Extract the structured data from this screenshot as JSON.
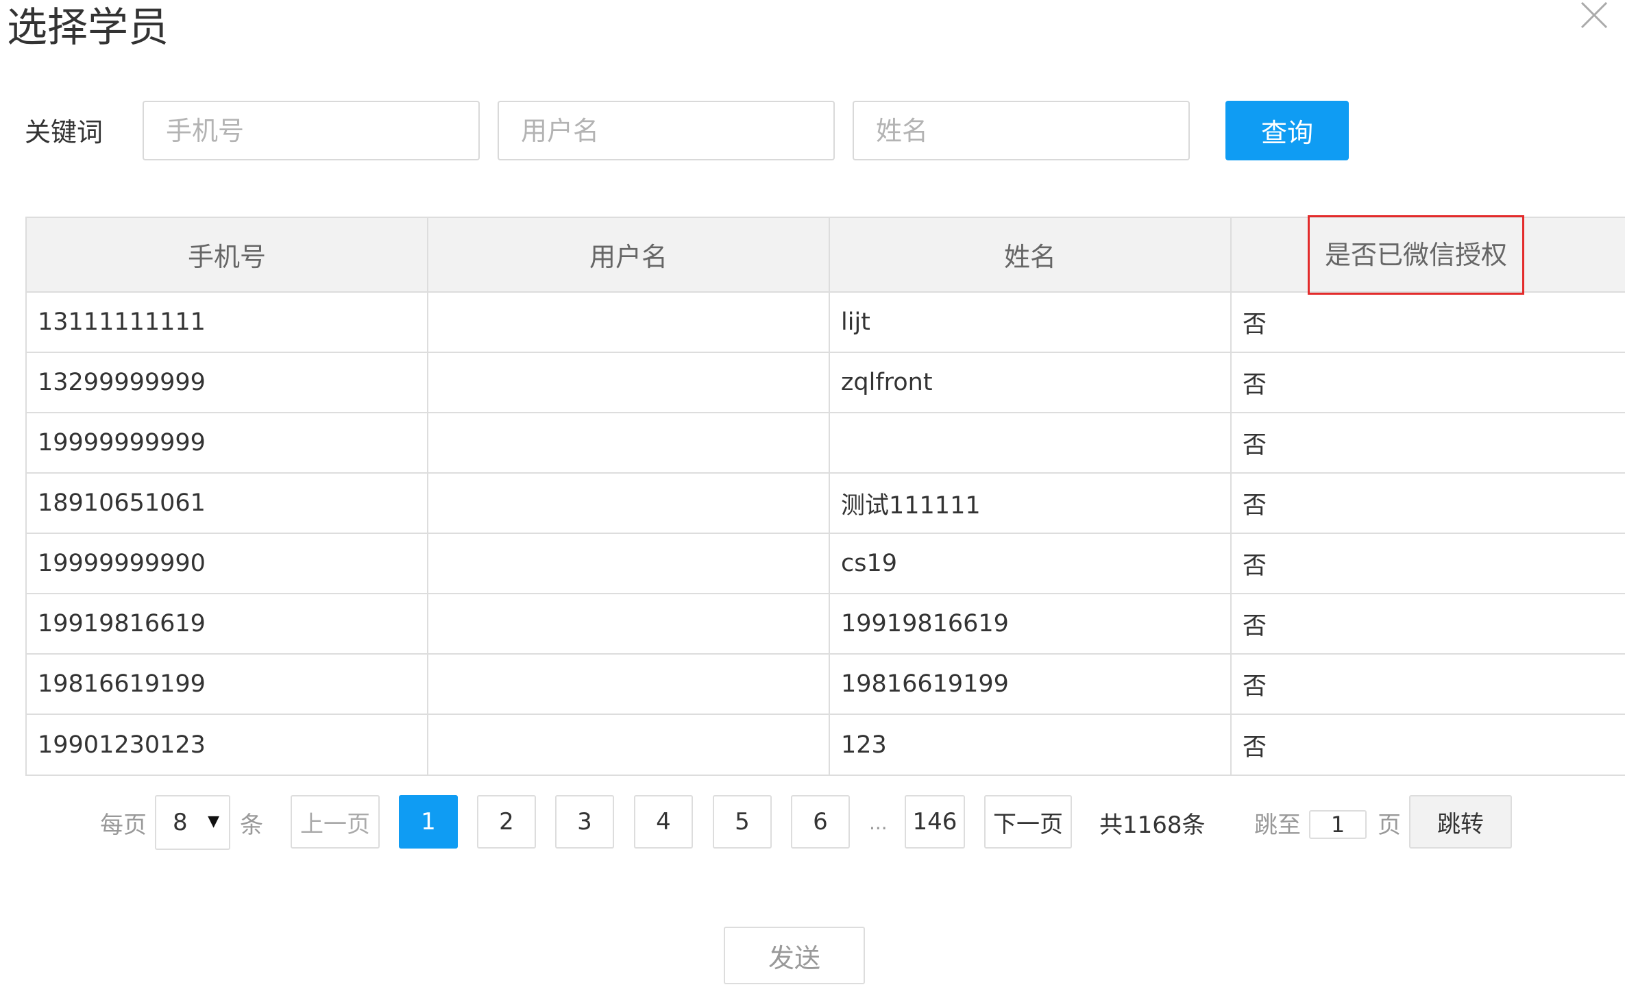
{
  "dialog": {
    "title": "选择学员",
    "close_icon": "close-icon"
  },
  "search": {
    "label": "关键词",
    "phone_placeholder": "手机号",
    "username_placeholder": "用户名",
    "name_placeholder": "姓名",
    "query_label": "查询"
  },
  "table": {
    "headers": [
      "手机号",
      "用户名",
      "姓名",
      "是否已微信授权"
    ],
    "highlight_color": "#e32b2b",
    "rows": [
      {
        "phone": "13111111111",
        "username": "",
        "name": "lijt",
        "wechat_auth": "否"
      },
      {
        "phone": "13299999999",
        "username": "",
        "name": "zqlfront",
        "wechat_auth": "否"
      },
      {
        "phone": "19999999999",
        "username": "",
        "name": "",
        "wechat_auth": "否"
      },
      {
        "phone": "18910651061",
        "username": "",
        "name": "测试111111",
        "wechat_auth": "否"
      },
      {
        "phone": "19999999990",
        "username": "",
        "name": "cs19",
        "wechat_auth": "否"
      },
      {
        "phone": "19919816619",
        "username": "",
        "name": "19919816619",
        "wechat_auth": "否"
      },
      {
        "phone": "19816619199",
        "username": "",
        "name": "19816619199",
        "wechat_auth": "否"
      },
      {
        "phone": "19901230123",
        "username": "",
        "name": "123",
        "wechat_auth": "否"
      }
    ]
  },
  "pagination": {
    "per_page_prefix": "每页",
    "per_page_value": "8",
    "per_page_suffix": "条",
    "prev_label": "上一页",
    "pages": [
      "1",
      "2",
      "3",
      "4",
      "5",
      "6"
    ],
    "current_page": "1",
    "ellipsis": "...",
    "last_page": "146",
    "next_label": "下一页",
    "total_text": "共1168条",
    "jump_prefix": "跳至",
    "jump_value": "1",
    "jump_suffix": "页",
    "jump_button": "跳转"
  },
  "footer": {
    "send_label": "发送"
  },
  "colors": {
    "accent": "#0f9cf3",
    "border": "#dddddd",
    "header_bg": "#f2f2f2"
  }
}
